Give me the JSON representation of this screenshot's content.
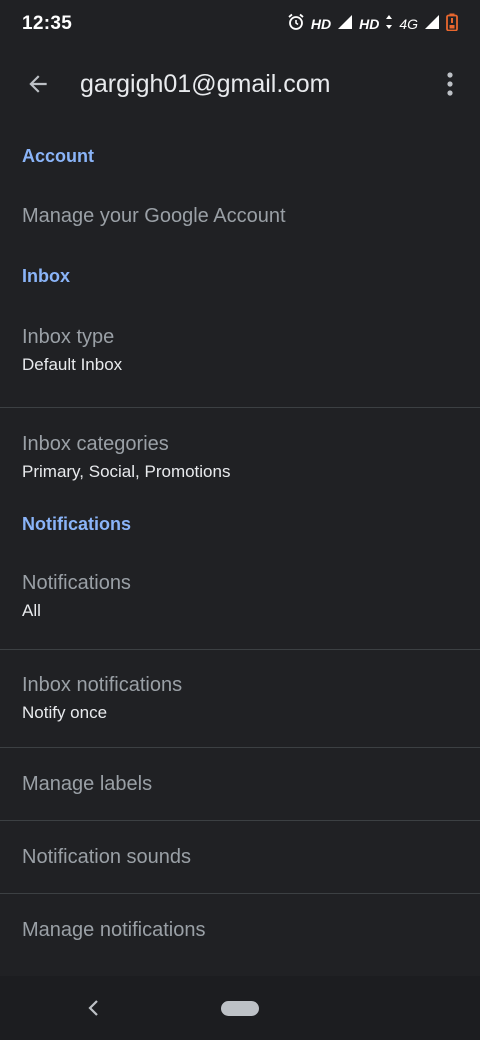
{
  "status_bar": {
    "time": "12:35",
    "hd1": "HD",
    "hd2": "HD",
    "network": "4G",
    "icons": [
      "alarm-icon",
      "signal-icon",
      "signal-icon",
      "battery-icon"
    ],
    "battery_color": "#e8672e"
  },
  "app_bar": {
    "title": "gargigh01@gmail.com",
    "back_icon": "arrow-back-icon",
    "more_icon": "more-vert-icon"
  },
  "sections": {
    "account": {
      "header": "Account",
      "items": [
        {
          "title": "Manage your Google Account"
        }
      ]
    },
    "inbox": {
      "header": "Inbox",
      "items": [
        {
          "title": "Inbox type",
          "subtitle": "Default Inbox"
        },
        {
          "title": "Inbox categories",
          "subtitle": "Primary, Social, Promotions"
        }
      ]
    },
    "notifications": {
      "header": "Notifications",
      "items": [
        {
          "title": "Notifications",
          "subtitle": "All"
        },
        {
          "title": "Inbox notifications",
          "subtitle": "Notify once"
        },
        {
          "title": "Manage labels"
        },
        {
          "title": "Notification sounds"
        },
        {
          "title": "Manage notifications"
        }
      ]
    }
  },
  "colors": {
    "background": "#202124",
    "accent": "#8ab4f8",
    "title_text": "#9aa0a6",
    "subtitle_text": "#e8eaed",
    "divider": "#3c4043"
  },
  "nav_bar": {
    "back_icon": "nav-back-icon",
    "home_icon": "nav-home-pill"
  }
}
